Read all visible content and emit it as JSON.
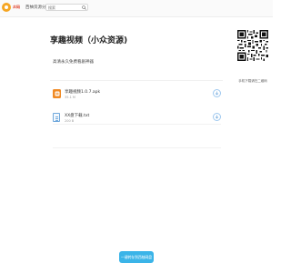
{
  "header": {
    "logo_badge": "众码",
    "site_name": "西柚资源分享",
    "search": {
      "placeholder": "搜索",
      "value": ""
    }
  },
  "page": {
    "title": "享趣视频（小众资源)",
    "description": "高清永久免费看剧神器"
  },
  "files": [
    {
      "name": "享趣视频1.0.7.apk",
      "size": "35.1 M",
      "type": "apk"
    },
    {
      "name": "XX盘下载.txt",
      "size": "200 B",
      "type": "txt"
    }
  ],
  "sidebar": {
    "qr_caption": "手机下载请扫二维码"
  },
  "footer": {
    "app_button_label": "一键转存到西柚网盘"
  },
  "colors": {
    "accent": "#3bb4e8",
    "brand": "#f5a623",
    "apk_icon": "#f08a24"
  }
}
